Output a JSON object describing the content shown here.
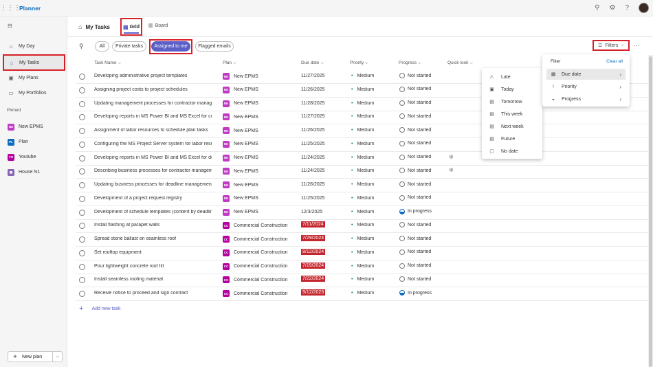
{
  "app": {
    "title": "Planner"
  },
  "sidebar": {
    "items": [
      {
        "label": "My Day",
        "icon": "sun-icon"
      },
      {
        "label": "My Tasks",
        "icon": "home-icon"
      },
      {
        "label": "My Plans",
        "icon": "plans-icon"
      },
      {
        "label": "My Portfolios",
        "icon": "portfolio-icon"
      }
    ],
    "pinned_label": "Pinned",
    "pinned": [
      {
        "label": "New EPMS",
        "badge": "NE",
        "color": "#c03bc4"
      },
      {
        "label": "Plan",
        "badge": "PL",
        "color": "#0f6cbd"
      },
      {
        "label": "Youtube",
        "badge": "YO",
        "color": "#b4009e"
      },
      {
        "label": "House N1",
        "badge": "",
        "color": "#8764b8"
      }
    ],
    "new_plan": "New plan"
  },
  "header": {
    "title": "My Tasks",
    "tab_grid": "Grid",
    "tab_board": "Board"
  },
  "toolbar": {
    "pills": [
      "All",
      "Private tasks",
      "Assigned to me",
      "Flagged emails"
    ],
    "filters": "Filters"
  },
  "columns": [
    "Task Name",
    "Plan",
    "Due date",
    "Priority",
    "Progress",
    "Quick look"
  ],
  "tasks": [
    {
      "name": "Developing administrative project templates",
      "plan": "New EPMS",
      "badge": "NE",
      "due": "11/27/2025",
      "overdue": false,
      "priority": "Medium",
      "progress": "Not started",
      "ql": ""
    },
    {
      "name": "Assigning project costs to project schedules",
      "plan": "New EPMS",
      "badge": "NE",
      "due": "11/26/2025",
      "overdue": false,
      "priority": "Medium",
      "progress": "Not started",
      "ql": ""
    },
    {
      "name": "Updating management processes for contractor management",
      "plan": "New EPMS",
      "badge": "NE",
      "due": "11/28/2025",
      "overdue": false,
      "priority": "Medium",
      "progress": "Not started",
      "ql": ""
    },
    {
      "name": "Developing reports in MS Power BI and MS Excel for contractors",
      "plan": "New EPMS",
      "badge": "NE",
      "due": "11/27/2025",
      "overdue": false,
      "priority": "Medium",
      "progress": "Not started",
      "ql": ""
    },
    {
      "name": "Assignment of labor resources to schedule plan tasks",
      "plan": "New EPMS",
      "badge": "NE",
      "due": "11/26/2025",
      "overdue": false,
      "priority": "Medium",
      "progress": "Not started",
      "ql": ""
    },
    {
      "name": "Configuring the MS Project Server system for labor resources",
      "plan": "New EPMS",
      "badge": "NE",
      "due": "11/25/2025",
      "overdue": false,
      "priority": "Medium",
      "progress": "Not started",
      "ql": ""
    },
    {
      "name": "Developing reports in MS Power BI and MS Excel for department",
      "plan": "New EPMS",
      "badge": "NE",
      "due": "11/24/2025",
      "overdue": false,
      "priority": "Medium",
      "progress": "Not started",
      "ql": "✻"
    },
    {
      "name": "Describing business processes for contractor management",
      "plan": "New EPMS",
      "badge": "NE",
      "due": "11/24/2025",
      "overdue": false,
      "priority": "Medium",
      "progress": "Not started",
      "ql": "✻"
    },
    {
      "name": "Updating business processes for deadline management",
      "plan": "New EPMS",
      "badge": "NE",
      "due": "11/26/2025",
      "overdue": false,
      "priority": "Medium",
      "progress": "Not started",
      "ql": ""
    },
    {
      "name": "Development of a project request registry",
      "plan": "New EPMS",
      "badge": "NE",
      "due": "11/25/2025",
      "overdue": false,
      "priority": "Medium",
      "progress": "Not started",
      "ql": ""
    },
    {
      "name": "Development of schedule templates (content by deadline)",
      "plan": "New EPMS",
      "badge": "NE",
      "due": "12/3/2025",
      "overdue": false,
      "priority": "Medium",
      "progress": "In progress",
      "ql": ""
    },
    {
      "name": "Install flashing at parapet walls",
      "plan": "Commercial Construction",
      "badge": "CC",
      "due": "7/11/2024",
      "overdue": true,
      "priority": "Medium",
      "progress": "Not started",
      "ql": ""
    },
    {
      "name": "Spread stone ballast on seamless roof",
      "plan": "Commercial Construction",
      "badge": "CC",
      "due": "7/29/2024",
      "overdue": true,
      "priority": "Medium",
      "progress": "Not started",
      "ql": ""
    },
    {
      "name": "Set rooftop equipment",
      "plan": "Commercial Construction",
      "badge": "CC",
      "due": "8/12/2024",
      "overdue": true,
      "priority": "Medium",
      "progress": "Not started",
      "ql": ""
    },
    {
      "name": "Pour lightweight concrete roof fill",
      "plan": "Commercial Construction",
      "badge": "CC",
      "due": "7/15/2024",
      "overdue": true,
      "priority": "Medium",
      "progress": "Not started",
      "ql": ""
    },
    {
      "name": "Install seamless roofing material",
      "plan": "Commercial Construction",
      "badge": "CC",
      "due": "7/22/2024",
      "overdue": true,
      "priority": "Medium",
      "progress": "Not started",
      "ql": ""
    },
    {
      "name": "Receive notice to proceed and sign contract",
      "plan": "Commercial Construction",
      "badge": "CC",
      "due": "9/12/2023",
      "overdue": true,
      "priority": "Medium",
      "progress": "In progress",
      "ql": ""
    }
  ],
  "add_task": "Add new task",
  "filter_panel": {
    "title": "Filter",
    "clear": "Clear all",
    "items": [
      "Due date",
      "Priority",
      "Progress"
    ]
  },
  "due_submenu": [
    "Late",
    "Today",
    "Tomorrow",
    "This week",
    "Next week",
    "Future",
    "No date"
  ],
  "colors": {
    "accent": "#5b5fc7",
    "overdue": "#c4262e",
    "highlight": "#d62027",
    "ne": "#c03bc4",
    "cc": "#b4009e"
  }
}
